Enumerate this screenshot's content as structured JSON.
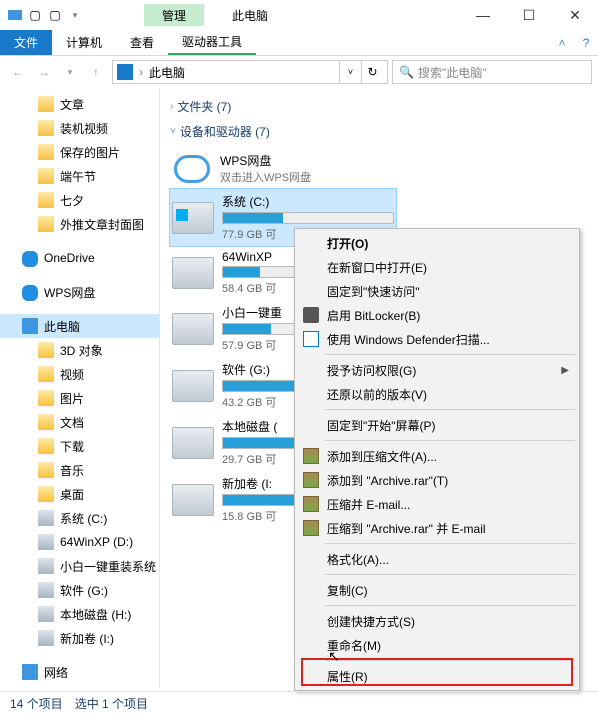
{
  "titlebar": {
    "contextual_tab": "管理",
    "title": "此电脑"
  },
  "ribbon": {
    "file": "文件",
    "computer": "计算机",
    "view": "查看",
    "drive_tools": "驱动器工具"
  },
  "address": {
    "path_text": "此电脑",
    "search_placeholder": "搜索\"此电脑\""
  },
  "tree": {
    "quick": [
      "文章",
      "装机视频",
      "保存的图片",
      "端午节",
      "七夕",
      "外推文章封面图"
    ],
    "onedrive": "OneDrive",
    "wps": "WPS网盘",
    "thispc": "此电脑",
    "pc_children": [
      "3D 对象",
      "视频",
      "图片",
      "文档",
      "下载",
      "音乐",
      "桌面"
    ],
    "drives": [
      "系统 (C:)",
      "64WinXP  (D:)",
      "小白一键重装系统",
      "软件 (G:)",
      "本地磁盘 (H:)",
      "新加卷 (I:)"
    ],
    "network": "网络"
  },
  "content": {
    "group_folders": "文件夹 (7)",
    "group_devices": "设备和驱动器 (7)",
    "wps": {
      "name": "WPS网盘",
      "sub": "双击进入WPS网盘"
    },
    "drives": [
      {
        "name": "系统 (C:)",
        "free": "77.9 GB 可",
        "fill": 35,
        "win": true
      },
      {
        "name": "64WinXP",
        "free": "58.4 GB 可",
        "fill": 22
      },
      {
        "name": "小白一键重",
        "free": "57.9 GB 可",
        "fill": 28
      },
      {
        "name": "软件 (G:)",
        "free": "43.2 GB 可",
        "fill": 42
      },
      {
        "name": "本地磁盘 (",
        "free": "29.7 GB 可",
        "fill": 55
      },
      {
        "name": "新加卷 (I:",
        "free": "15.8 GB 可",
        "fill": 68
      }
    ]
  },
  "ctx": {
    "open": "打开(O)",
    "open_new": "在新窗口中打开(E)",
    "pin_quick": "固定到\"快速访问\"",
    "bitlocker": "启用 BitLocker(B)",
    "defender": "使用 Windows Defender扫描...",
    "grant": "授予访问权限(G)",
    "restore": "还原以前的版本(V)",
    "pin_start": "固定到\"开始\"屏幕(P)",
    "add_zip": "添加到压缩文件(A)...",
    "add_rar": "添加到 \"Archive.rar\"(T)",
    "zip_mail": "压缩并 E-mail...",
    "rar_mail": "压缩到 \"Archive.rar\" 并 E-mail",
    "format": "格式化(A)...",
    "copy": "复制(C)",
    "shortcut": "创建快捷方式(S)",
    "rename": "重命名(M)",
    "properties": "属性(R)"
  },
  "status": {
    "count": "14 个项目",
    "selected": "选中 1 个项目"
  }
}
